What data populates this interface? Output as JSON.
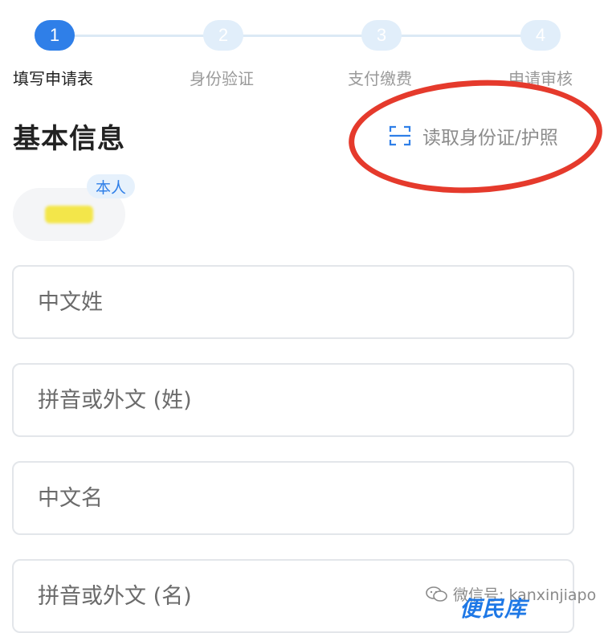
{
  "stepper": {
    "steps": [
      {
        "number": "1",
        "label": "填写申请表"
      },
      {
        "number": "2",
        "label": "身份验证"
      },
      {
        "number": "3",
        "label": "支付缴费"
      },
      {
        "number": "4",
        "label": "申请审核"
      }
    ],
    "active_index": 0
  },
  "section": {
    "title": "基本信息",
    "read_id_label": "读取身份证/护照",
    "read_id_icon": "scan-icon"
  },
  "person": {
    "badge": "本人"
  },
  "form": {
    "fields": [
      {
        "placeholder": "中文姓"
      },
      {
        "placeholder": "拼音或外文 (姓)"
      },
      {
        "placeholder": "中文名"
      },
      {
        "placeholder": "拼音或外文 (名)"
      }
    ]
  },
  "watermark": {
    "line1": "微信号: kanxinjiapo",
    "line2": "便民库"
  },
  "colors": {
    "accent": "#2f7fe8",
    "annotation_red": "#e53a2c",
    "step_inactive": "#e1eefa"
  }
}
